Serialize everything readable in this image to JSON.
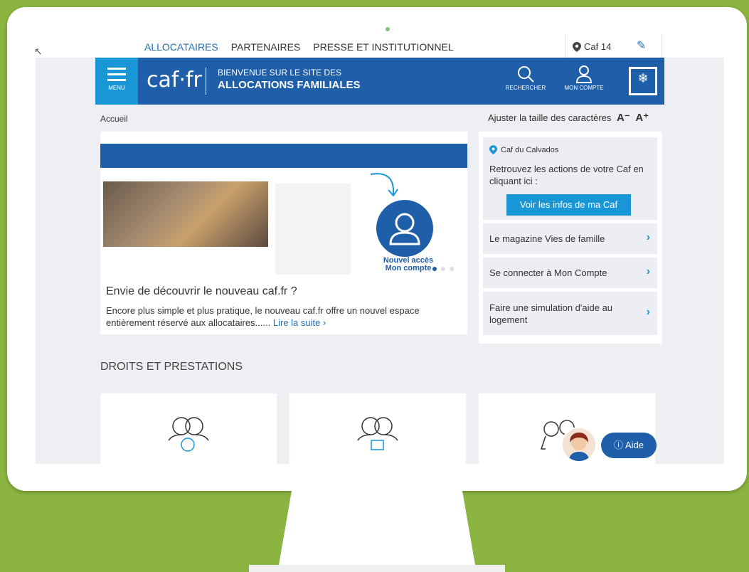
{
  "top_nav": {
    "links": [
      "ALLOCATAIRES",
      "PARTENAIRES",
      "PRESSE ET INSTITUTIONNEL"
    ],
    "caf_label": "Caf 14"
  },
  "header": {
    "menu_label": "MENU",
    "logo": "caf·fr",
    "welcome_line1": "BIENVENUE SUR LE SITE DES",
    "welcome_line2": "ALLOCATIONS FAMILIALES",
    "search_label": "RECHERCHER",
    "account_label": "MON COMPTE"
  },
  "breadcrumb": "Accueil",
  "font_size": {
    "label": "Ajuster la taille des caractères",
    "minus": "A⁻",
    "plus": "A⁺"
  },
  "carousel": {
    "badge": "Nouvel accès Mon compte",
    "title": "Envie de découvrir le nouveau caf.fr ?",
    "desc": "Encore plus simple et plus pratique, le nouveau caf.fr offre un nouvel espace entièrement réservé aux allocataires......",
    "more": "Lire la suite ›"
  },
  "right": {
    "caf_name": "Caf du Calvados",
    "caf_text": "Retrouvez les actions de votre Caf en cliquant ici :",
    "caf_button": "Voir les infos de ma Caf",
    "items": [
      "Le magazine Vies de famille",
      "Se connecter à Mon Compte",
      "Faire une simulation d'aide au logement"
    ]
  },
  "droits_title": "DROITS ET PRESTATIONS",
  "aide_label": "Aide",
  "colors": {
    "header": "#1f5ea8",
    "accent": "#1996d5",
    "background": "#8bb540"
  }
}
